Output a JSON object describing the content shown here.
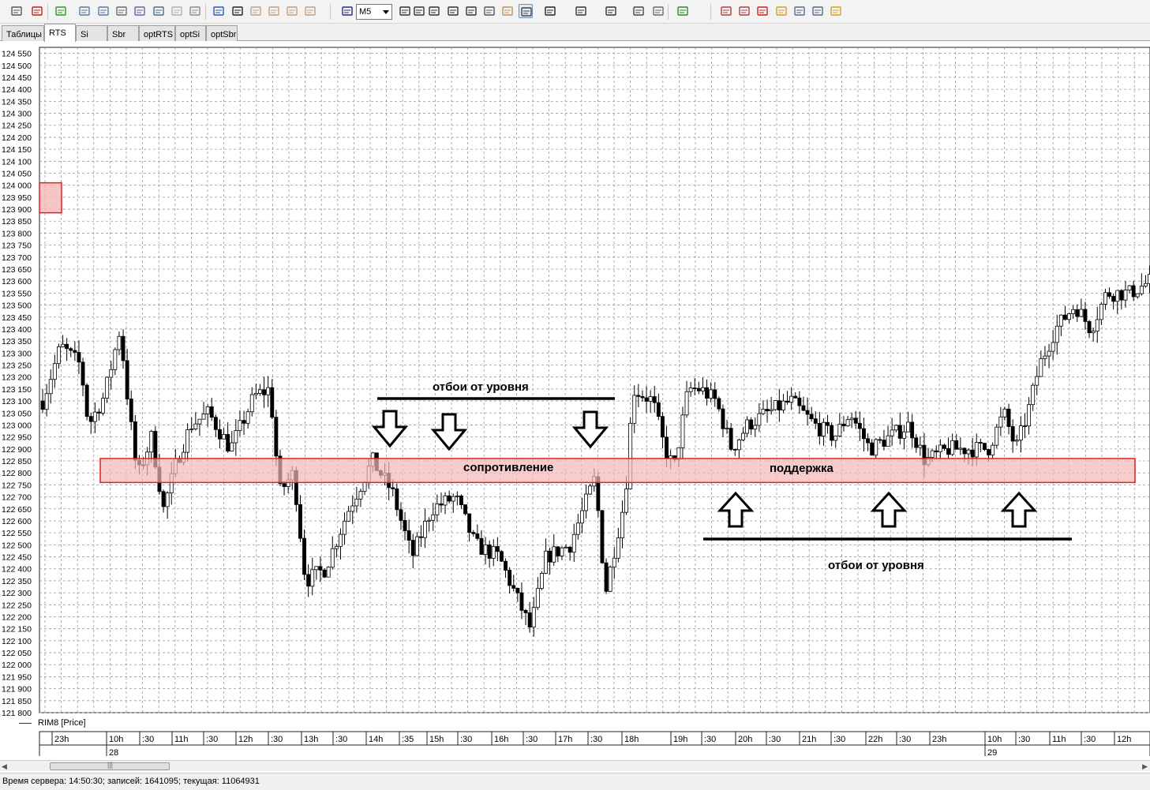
{
  "toolbar": {
    "timeframe": "M5",
    "icons": [
      "link-icon",
      "remove-icon",
      "add-chart-icon",
      "window-icon",
      "window2-icon",
      "list-icon",
      "chart-props-icon",
      "zoom-chart-icon",
      "chart-disabled-icon",
      "chart-copy-icon",
      "alert-icon",
      "text-tool-icon",
      "hand-icon",
      "hand2-icon",
      "hand3-icon",
      "hand4-icon",
      "candles-icon",
      "crosshair-icon",
      "cursor-arrow-icon",
      "move-icon",
      "zoom-in-icon",
      "zoom-out-icon",
      "ruler-icon",
      "pointer-hand-icon",
      "pan-hand-icon",
      "rectangle-icon",
      "font-icon",
      "fill-icon",
      "eraser-icon",
      "eraser2-icon",
      "indicator-icon",
      "portfolio-icon",
      "orders-icon",
      "stop-icon",
      "money-icon",
      "print-icon",
      "mail-icon",
      "export-icon"
    ]
  },
  "tabs": [
    {
      "label": "Таблицы",
      "active": false
    },
    {
      "label": "RTS",
      "active": true
    },
    {
      "label": "Si",
      "active": false
    },
    {
      "label": "Sbr",
      "active": false
    },
    {
      "label": "optRTS",
      "active": false
    },
    {
      "label": "optSi",
      "active": false
    },
    {
      "label": "optSbr",
      "active": false
    }
  ],
  "legend": {
    "series_name": "RIM8 [Price]"
  },
  "annotations": {
    "top_bounce_label": "отбои от уровня",
    "resistance_label": "сопротивление",
    "support_label": "поддержка",
    "bottom_bounce_label": "отбои от уровня"
  },
  "chart_data": {
    "type": "candlestick",
    "ylim": [
      121800,
      124575
    ],
    "y_ticks": [
      124550,
      124500,
      124450,
      124400,
      124350,
      124300,
      124250,
      124200,
      124150,
      124100,
      124050,
      124000,
      123950,
      123900,
      123850,
      123800,
      123750,
      123700,
      123650,
      123600,
      123550,
      123500,
      123450,
      123400,
      123350,
      123300,
      123250,
      123200,
      123150,
      123100,
      123050,
      123000,
      122950,
      122900,
      122850,
      122800,
      122750,
      122700,
      122650,
      122600,
      122550,
      122500,
      122450,
      122400,
      122350,
      122300,
      122250,
      122200,
      122150,
      122100,
      122050,
      122000,
      121950,
      121900,
      121850,
      121800
    ],
    "x_tick_labels": [
      "23h",
      "10h",
      ":30",
      "11h",
      ":30",
      "12h",
      ":30",
      "13h",
      ":30",
      "14h",
      ":35",
      "15h",
      ":30",
      "16h",
      ":30",
      "17h",
      ":30",
      "18h",
      "19h",
      ":30",
      "20h",
      ":30",
      "21h",
      ":30",
      "22h",
      ":30",
      "23h",
      "10h",
      ":30",
      "11h",
      ":30",
      "12h"
    ],
    "date_labels": [
      "28",
      "29"
    ],
    "level_zone": [
      122760,
      122860
    ],
    "price_range": {
      "low": 122020,
      "high": 123670,
      "start": 123080,
      "end": 123600
    },
    "colors": {
      "up": "#ffffff",
      "down": "#000000",
      "zone_fill": "#f4b6b6",
      "zone_border": "#e02020"
    }
  },
  "statusbar": {
    "text": "Время сервера: 14:50:30; записей: 1641095; текущая: 11064931"
  }
}
